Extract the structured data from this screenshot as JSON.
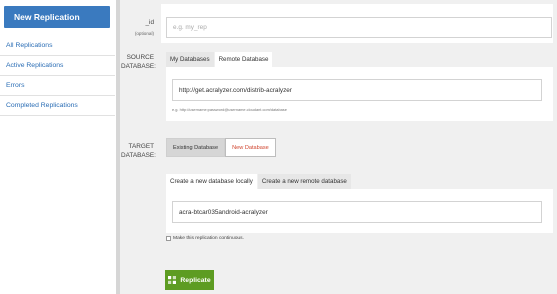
{
  "sidebar": {
    "new_replication": "New Replication",
    "items": [
      {
        "label": "All Replications"
      },
      {
        "label": "Active Replications"
      },
      {
        "label": "Errors"
      },
      {
        "label": "Completed Replications"
      }
    ]
  },
  "id_field": {
    "label": "_id",
    "sublabel": "(optional)",
    "placeholder": "e.g. my_rep"
  },
  "source": {
    "label_line1": "SOURCE",
    "label_line2": "DATABASE:",
    "tabs": [
      "My Databases",
      "Remote Database"
    ],
    "active_tab": "Remote Database",
    "url_value": "http://get.acralyzer.com/distrib-acralyzer",
    "hint": "e.g. http://username:password@username.cloudant.com/database"
  },
  "target": {
    "label_line1": "TARGET",
    "label_line2": "DATABASE:",
    "buttons": [
      "Existing Database",
      "New Database"
    ],
    "tabs": [
      "Create a new database locally",
      "Create a new remote database"
    ],
    "active_tab": "Create a new database locally",
    "db_name_value": "acra-btcar035android-acralyzer"
  },
  "continuous": {
    "label": "Make this replication continuous."
  },
  "replicate_button": "Replicate",
  "colors": {
    "primary_blue": "#3a7abf",
    "link_blue": "#2a6db5",
    "replicate_green": "#5d9c22",
    "new_db_red": "#d0452f"
  }
}
